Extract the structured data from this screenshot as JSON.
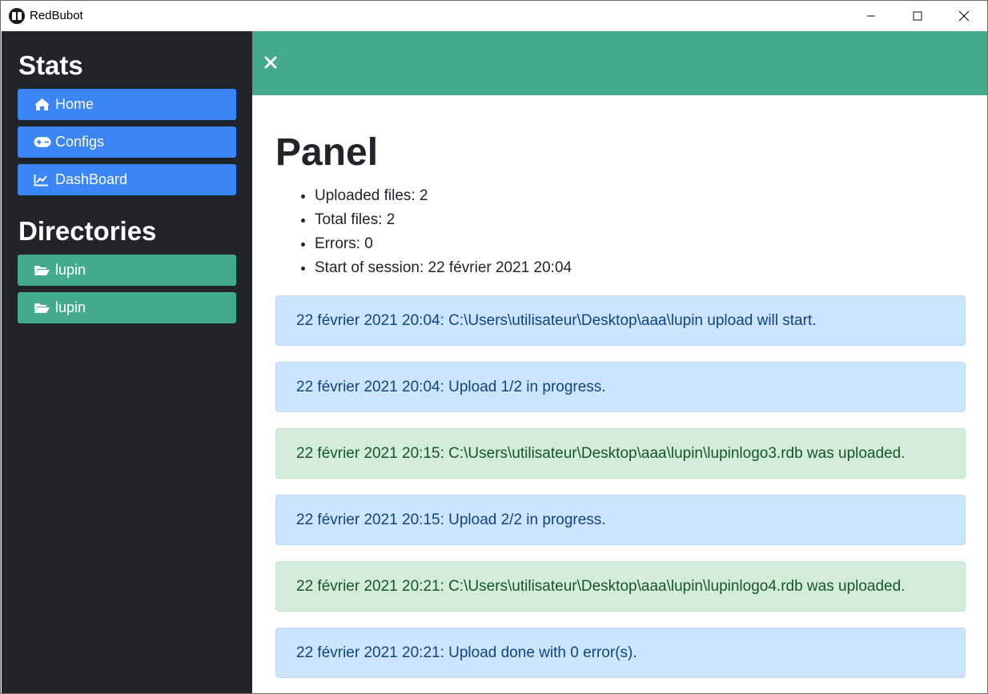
{
  "window": {
    "title": "RedBubot"
  },
  "sidebar": {
    "stats_heading": "Stats",
    "stats_items": [
      {
        "label": "Home",
        "icon": "home-icon"
      },
      {
        "label": "Configs",
        "icon": "gamepad-icon"
      },
      {
        "label": "DashBoard",
        "icon": "chart-line-icon"
      }
    ],
    "directories_heading": "Directories",
    "directory_items": [
      {
        "label": "lupin",
        "icon": "folder-open-icon"
      },
      {
        "label": "lupin",
        "icon": "folder-open-icon"
      }
    ]
  },
  "panel": {
    "title": "Panel",
    "stats": [
      "Uploaded files: 2",
      "Total files: 2",
      "Errors: 0",
      "Start of session: 22 février 2021 20:04"
    ]
  },
  "log": [
    {
      "type": "info",
      "text": "22 février 2021 20:04: C:\\Users\\utilisateur\\Desktop\\aaa\\lupin upload will start."
    },
    {
      "type": "info",
      "text": "22 février 2021 20:04: Upload 1/2 in progress."
    },
    {
      "type": "success",
      "text": "22 février 2021 20:15: C:\\Users\\utilisateur\\Desktop\\aaa\\lupin\\lupinlogo3.rdb was uploaded."
    },
    {
      "type": "info",
      "text": "22 février 2021 20:15: Upload 2/2 in progress."
    },
    {
      "type": "success",
      "text": "22 février 2021 20:21: C:\\Users\\utilisateur\\Desktop\\aaa\\lupin\\lupinlogo4.rdb was uploaded."
    },
    {
      "type": "info",
      "text": "22 février 2021 20:21: Upload done with 0 error(s)."
    }
  ],
  "colors": {
    "sidebar_bg": "#212529",
    "primary": "#3b86f7",
    "accent_green": "#43aa8b",
    "alert_info_bg": "#cce5fd",
    "alert_success_bg": "#d4edda"
  }
}
